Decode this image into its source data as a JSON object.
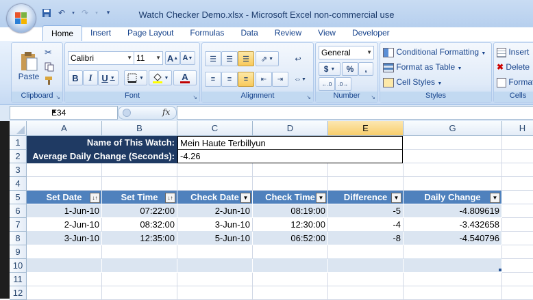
{
  "window": {
    "title": "Watch Checker Demo.xlsx - Microsoft Excel non-commercial use"
  },
  "quick_access": [
    "save-icon",
    "undo-icon",
    "redo-icon",
    "customize-icon"
  ],
  "tabs": [
    "Home",
    "Insert",
    "Page Layout",
    "Formulas",
    "Data",
    "Review",
    "View",
    "Developer"
  ],
  "active_tab": "Home",
  "ribbon": {
    "clipboard": {
      "label": "Clipboard",
      "paste": "Paste"
    },
    "font": {
      "label": "Font",
      "name": "Calibri",
      "size": "11",
      "grow": "A",
      "shrink": "A",
      "bold": "B",
      "italic": "I",
      "underline": "U",
      "font_color": "A"
    },
    "alignment": {
      "label": "Alignment"
    },
    "number": {
      "label": "Number",
      "format": "General",
      "currency": "$",
      "percent": "%",
      "comma": ","
    },
    "styles": {
      "label": "Styles",
      "conditional": "Conditional Formatting",
      "format_table": "Format as Table",
      "cell_styles": "Cell Styles"
    },
    "cells": {
      "label": "Cells",
      "insert": "Insert",
      "delete": "Delete",
      "format": "Format"
    }
  },
  "formula_bar": {
    "name_box": "E34",
    "fx": "fx",
    "value": ""
  },
  "columns": [
    "A",
    "B",
    "C",
    "D",
    "E",
    "G",
    "H"
  ],
  "selected_column": "E",
  "rows": [
    "1",
    "2",
    "3",
    "4",
    "5",
    "6",
    "7",
    "8",
    "9",
    "10",
    "11",
    "12"
  ],
  "summary": {
    "watch_label": "Name of This Watch:",
    "watch_value": "Mein Haute Terbillyun",
    "change_label": "Average Daily Change (Seconds):",
    "change_value": "-4.26"
  },
  "table": {
    "headers": [
      "Set Date",
      "Set Time",
      "Check Date",
      "Check Time",
      "Difference",
      "Daily Change"
    ],
    "rows": [
      [
        "1-Jun-10",
        "07:22:00",
        "2-Jun-10",
        "08:19:00",
        "-5",
        "-4.809619"
      ],
      [
        "2-Jun-10",
        "08:32:00",
        "3-Jun-10",
        "12:30:00",
        "-4",
        "-3.432658"
      ],
      [
        "3-Jun-10",
        "12:35:00",
        "5-Jun-10",
        "06:52:00",
        "-8",
        "-4.540796"
      ]
    ]
  }
}
